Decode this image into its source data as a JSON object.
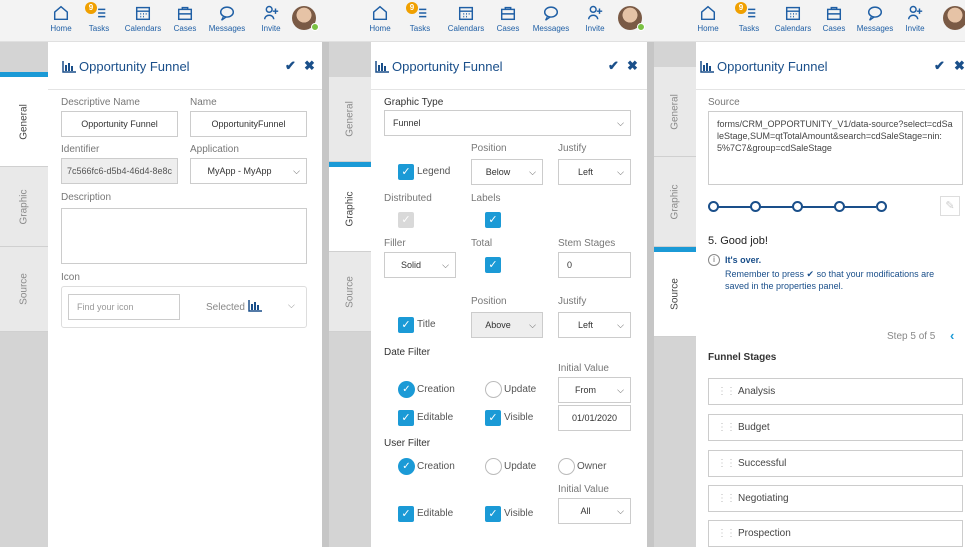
{
  "nav": {
    "home": "Home",
    "tasks": "Tasks",
    "tasks_badge": "9",
    "calendars": "Calendars",
    "cases": "Cases",
    "messages": "Messages",
    "invite": "Invite"
  },
  "tabs": {
    "general": "General",
    "graphic": "Graphic",
    "source": "Source"
  },
  "form_title": "Opportunity Funnel",
  "panel_general": {
    "descriptive_name_label": "Descriptive Name",
    "descriptive_name_value": "Opportunity Funnel",
    "name_label": "Name",
    "name_value": "OpportunityFunnel",
    "identifier_label": "Identifier",
    "identifier_value": "7c566fc6-d5b4-46d4-8e8c",
    "application_label": "Application",
    "application_value": "MyApp - MyApp",
    "description_label": "Description",
    "description_value": "",
    "icon_label": "Icon",
    "icon_placeholder": "Find your icon",
    "icon_selected_label": "Selected"
  },
  "panel_graphic": {
    "graphic_type_label": "Graphic Type",
    "graphic_type_value": "Funnel",
    "position_label": "Position",
    "justify_label": "Justify",
    "legend_label": "Legend",
    "legend_position": "Below",
    "legend_justify": "Left",
    "distributed_label": "Distributed",
    "labels_label": "Labels",
    "filler_label": "Filler",
    "filler_value": "Solid",
    "total_label": "Total",
    "stem_stages_label": "Stem Stages",
    "stem_stages_value": "0",
    "position2_label": "Position",
    "justify2_label": "Justify",
    "title_label": "Title",
    "title_position": "Above",
    "title_justify": "Left",
    "date_filter_label": "Date Filter",
    "date_initial_value_label": "Initial Value",
    "creation_label": "Creation",
    "update_label": "Update",
    "date_from": "From",
    "editable_label": "Editable",
    "visible_label": "Visible",
    "date_value": "01/01/2020",
    "user_filter_label": "User Filter",
    "user_creation_label": "Creation",
    "user_update_label": "Update",
    "user_owner_label": "Owner",
    "user_initial_value_label": "Initial Value",
    "user_editable_label": "Editable",
    "user_visible_label": "Visible",
    "user_all": "All"
  },
  "panel_source": {
    "source_label": "Source",
    "source_value": "forms/CRM_OPPORTUNITY_V1/data-source?select=cdSaleStage,SUM=qtTotalAmount&search=cdSaleStage=nin:5%7C7&group=cdSaleStage",
    "wizard_heading": "5. Good job!",
    "info_title": "It's over.",
    "info_text": "Remember to press ✔ so that your modifications are saved in the properties panel.",
    "step_text": "Step 5 of 5",
    "funnel_stages_label": "Funnel Stages",
    "stages": [
      "Analysis",
      "Budget",
      "Successful",
      "Negotiating",
      "Prospection"
    ]
  },
  "colors": {
    "accent": "#1b9ad6",
    "brand": "#1a4f8a",
    "badge": "#f0a000"
  }
}
